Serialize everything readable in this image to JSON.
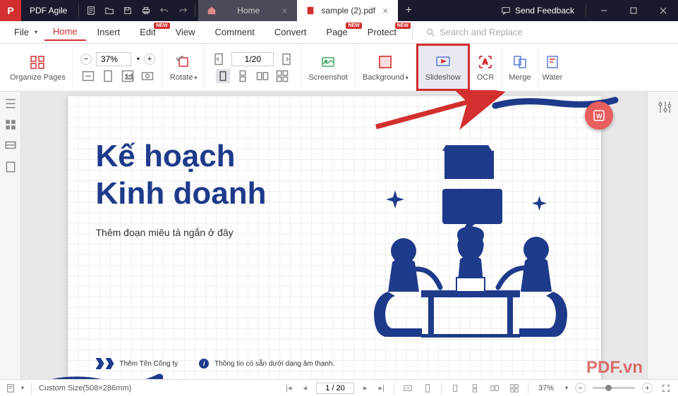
{
  "app": {
    "name": "PDF Agile"
  },
  "tabs": {
    "home": "Home",
    "file": {
      "name": "sample (2).pdf"
    }
  },
  "titlebar": {
    "feedback": "Send Feedback"
  },
  "menu": {
    "file": "File",
    "home": "Home",
    "insert": "Insert",
    "edit": "Edit",
    "view": "View",
    "comment": "Comment",
    "convert": "Convert",
    "page": "Page",
    "protect": "Protect",
    "search_placeholder": "Search and Replace",
    "new_badge": "NEW"
  },
  "ribbon": {
    "organize": "Organize Pages",
    "zoom": "37%",
    "rotate": "Rotate",
    "page_indicator": "1/20",
    "screenshot": "Screenshot",
    "background": "Background",
    "slideshow": "Slideshow",
    "ocr": "OCR",
    "merge": "Merge",
    "watermark": "Water"
  },
  "document": {
    "title_line1": "Kế hoạch",
    "title_line2": "Kinh doanh",
    "subtitle": "Thêm đoạn miêu tả ngắn ở đây",
    "footer_company": "Thêm Tên Công ty",
    "footer_audio": "Thông tin có sẵn dưới dạng âm thanh."
  },
  "statusbar": {
    "custom_size": "Custom Size(508×286mm)",
    "page": "1 / 20",
    "zoom": "37%"
  },
  "watermark": "PDF.vn"
}
